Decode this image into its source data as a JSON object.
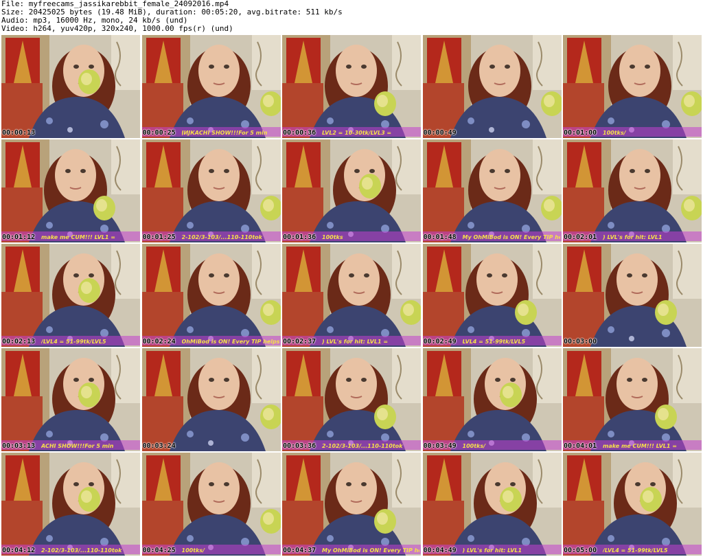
{
  "header": {
    "file_line": "File: myfreecams_jassikarebbit_female_24092016.mp4",
    "size_line": "Size: 20425025 bytes (19.48 MiB), duration: 00:05:20, avg.bitrate: 511 kb/s",
    "audio_line": "Audio: mp3, 16000 Hz, mono, 24 kb/s (und)",
    "video_line": "Video: h264, yuv420p, 320x240, 1000.00 fps(r) (und)"
  },
  "thumbnails": [
    {
      "timestamp": "00:00:13",
      "pose": "bite",
      "overlay_text": ""
    },
    {
      "timestamp": "00:00:25",
      "pose": "right",
      "overlay_text": "ЈИЈКАСНІ SHOW!!!For 5 min"
    },
    {
      "timestamp": "00:00:36",
      "pose": "center",
      "overlay_text": "LVL2 = 10-30tk/LVL3 ="
    },
    {
      "timestamp": "00:00:49",
      "pose": "right",
      "overlay_text": ""
    },
    {
      "timestamp": "00:01:00",
      "pose": "right",
      "overlay_text": "100tks/"
    },
    {
      "timestamp": "00:01:12",
      "pose": "center",
      "overlay_text": "make me CUM!!! LVL1 ="
    },
    {
      "timestamp": "00:01:25",
      "pose": "right",
      "overlay_text": "2-102/3-103/...110-110tok"
    },
    {
      "timestamp": "00:01:36",
      "pose": "bite",
      "overlay_text": "100tks"
    },
    {
      "timestamp": "00:01:48",
      "pose": "right",
      "overlay_text": "My OhMiBod is ON! Every TIP helps"
    },
    {
      "timestamp": "00:02:01",
      "pose": "right",
      "overlay_text": ") LVL's for hit: LVL1"
    },
    {
      "timestamp": "00:02:13",
      "pose": "bite",
      "overlay_text": "/LVL4 = 51-99tk/LVL5"
    },
    {
      "timestamp": "00:02:24",
      "pose": "right",
      "overlay_text": "OhMiBod is ON! Every TIP helps"
    },
    {
      "timestamp": "00:02:37",
      "pose": "right",
      "overlay_text": ") LVL's for hit: LVL1 ="
    },
    {
      "timestamp": "00:02:49",
      "pose": "center",
      "overlay_text": "LVL4 = 51-99tk/LVL5"
    },
    {
      "timestamp": "00:03:00",
      "pose": "center",
      "overlay_text": ""
    },
    {
      "timestamp": "00:03:13",
      "pose": "bite",
      "overlay_text": "ACHI SHOW!!!For 5 min"
    },
    {
      "timestamp": "00:03:24",
      "pose": "right",
      "overlay_text": ""
    },
    {
      "timestamp": "00:03:36",
      "pose": "center",
      "overlay_text": "2-102/3-103/...110-110tok"
    },
    {
      "timestamp": "00:03:49",
      "pose": "bite",
      "overlay_text": "100tks/"
    },
    {
      "timestamp": "00:04:01",
      "pose": "center",
      "overlay_text": "make me CUM!!! LVL1 ="
    },
    {
      "timestamp": "00:04:12",
      "pose": "bite",
      "overlay_text": "2-102/3-103/...110-110tok"
    },
    {
      "timestamp": "00:04:25",
      "pose": "right",
      "overlay_text": "100tks/"
    },
    {
      "timestamp": "00:04:37",
      "pose": "center",
      "overlay_text": "My OhMiBod is ON! Every TIP helps"
    },
    {
      "timestamp": "00:04:49",
      "pose": "bite",
      "overlay_text": ") LVL's for hit: LVL1"
    },
    {
      "timestamp": "00:05:00",
      "pose": "bite",
      "overlay_text": "/LVL4 = 51-99tk/LVL5"
    }
  ],
  "colors": {
    "wall_left": "#b8a27a",
    "wall_right": "#cfc7b4",
    "poster_red": "#b4281c",
    "poster_gold": "#d7a83a",
    "sofa": "#b3452c",
    "hair": "#6b2a18",
    "skin": "#e8c2a4",
    "shirt": "#3c4470",
    "apple": "#c8d454",
    "overlay_band": "#c23fd0",
    "overlay_text": "#f5e04a"
  }
}
